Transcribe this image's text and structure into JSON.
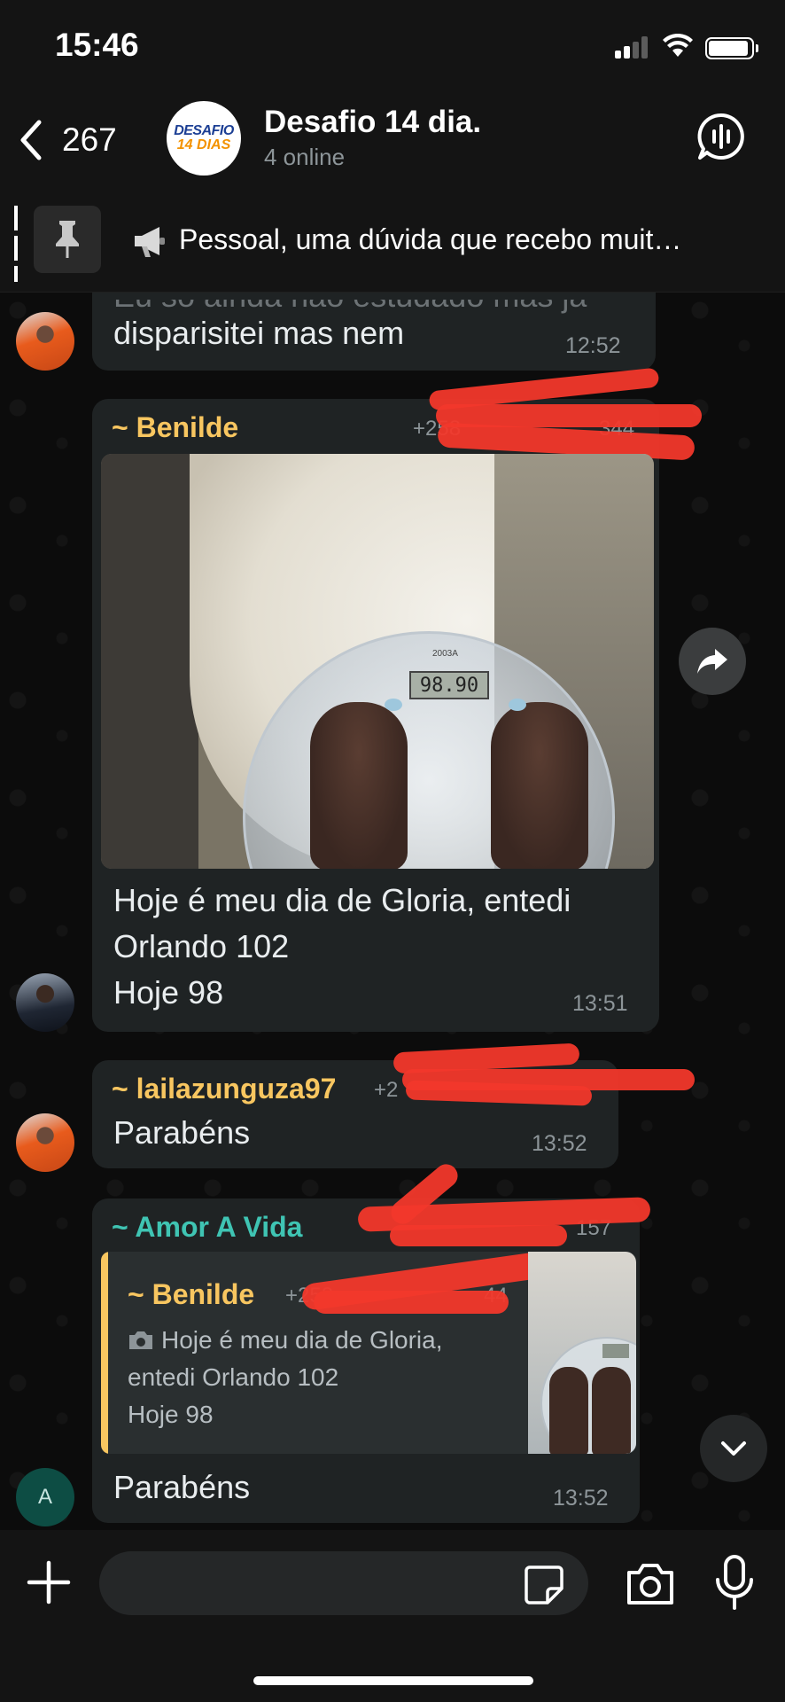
{
  "status_bar": {
    "time": "15:46"
  },
  "header": {
    "back_count": "267",
    "title": "Desafio 14 dia.",
    "subtitle": "4 online",
    "logo_line1": "DESAFIO",
    "logo_line2": "14 DIAS"
  },
  "pinned": {
    "text": "Pessoal, uma dúvida que recebo muit…"
  },
  "messages": [
    {
      "text_partial": "Eu so ainda nao estudado mas ja",
      "text": "disparisitei mas nem",
      "time": "12:52"
    },
    {
      "sender": "~ Benilde",
      "phone": "+258",
      "phone_tail": "344",
      "scale_reading": "98.90",
      "scale_model": "2003A",
      "text_lines": [
        "Hoje é meu dia de Gloria,  entedi",
        "Orlando 102",
        "Hoje 98"
      ],
      "time": "13:51"
    },
    {
      "sender": "~ lailazunguza97",
      "phone": "+2",
      "text": "Parabéns",
      "time": "13:52"
    },
    {
      "sender": "~ Amor A Vida",
      "phone_tail": "157",
      "quote": {
        "sender": "~ Benilde",
        "phone": "+258",
        "phone_tail": "44",
        "lines": [
          "Hoje é meu dia de Gloria,",
          "entedi Orlando 102",
          "Hoje 98"
        ]
      },
      "text": "Parabéns",
      "time": "13:52",
      "avatar_letter": "A"
    }
  ],
  "colors": {
    "sender_benilde": "#f8c660",
    "sender_laila": "#f8c660",
    "sender_amor": "#3fc4b3",
    "bubble": "#1f2324",
    "redaction": "#f2382b"
  },
  "input": {
    "placeholder": ""
  }
}
